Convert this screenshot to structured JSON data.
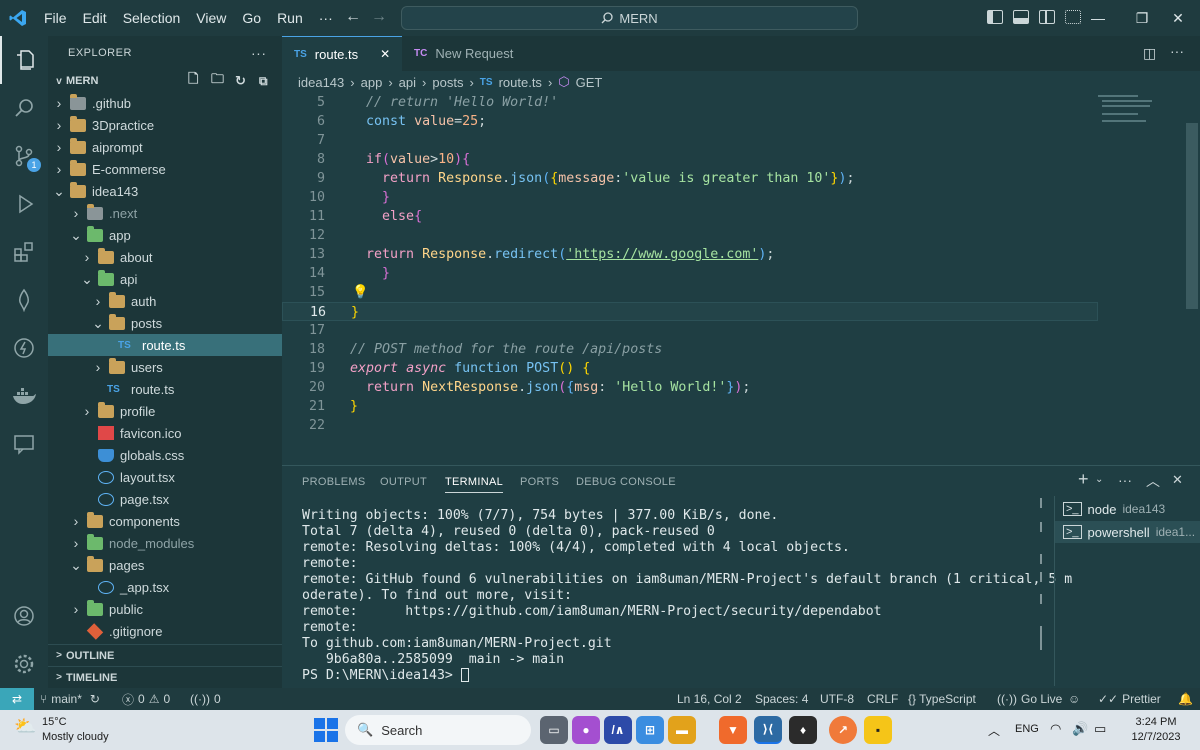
{
  "titlebar": {
    "menu": [
      "File",
      "Edit",
      "Selection",
      "View",
      "Go",
      "Run",
      "···"
    ],
    "search": "MERN"
  },
  "sidebar": {
    "header": "EXPLORER",
    "root": "MERN",
    "tree": [
      {
        "label": ".github",
        "depth": 1,
        "chevron": ">",
        "icon": "folder-github"
      },
      {
        "label": "3Dpractice",
        "depth": 1,
        "chevron": ">",
        "icon": "folder"
      },
      {
        "label": "aiprompt",
        "depth": 1,
        "chevron": ">",
        "icon": "folder"
      },
      {
        "label": "E-commerse",
        "depth": 1,
        "chevron": ">",
        "icon": "folder"
      },
      {
        "label": "idea143",
        "depth": 1,
        "chevron": "v",
        "icon": "folder"
      },
      {
        "label": ".next",
        "depth": 2,
        "chevron": ">",
        "icon": "folder-next"
      },
      {
        "label": "app",
        "depth": 2,
        "chevron": "v",
        "icon": "folder-green"
      },
      {
        "label": "about",
        "depth": 3,
        "chevron": ">",
        "icon": "folder"
      },
      {
        "label": "api",
        "depth": 3,
        "chevron": "v",
        "icon": "folder-green"
      },
      {
        "label": "auth",
        "depth": 4,
        "chevron": ">",
        "icon": "folder"
      },
      {
        "label": "posts",
        "depth": 4,
        "chevron": "v",
        "icon": "folder"
      },
      {
        "label": "route.ts",
        "depth": 5,
        "chevron": "",
        "icon": "ts",
        "selected": true
      },
      {
        "label": "users",
        "depth": 4,
        "chevron": ">",
        "icon": "folder"
      },
      {
        "label": "route.ts",
        "depth": 4,
        "chevron": "",
        "icon": "ts"
      },
      {
        "label": "profile",
        "depth": 3,
        "chevron": ">",
        "icon": "folder"
      },
      {
        "label": "favicon.ico",
        "depth": 3,
        "chevron": "",
        "icon": "favicon"
      },
      {
        "label": "globals.css",
        "depth": 3,
        "chevron": "",
        "icon": "css"
      },
      {
        "label": "layout.tsx",
        "depth": 3,
        "chevron": "",
        "icon": "react"
      },
      {
        "label": "page.tsx",
        "depth": 3,
        "chevron": "",
        "icon": "react"
      },
      {
        "label": "components",
        "depth": 2,
        "chevron": ">",
        "icon": "folder"
      },
      {
        "label": "node_modules",
        "depth": 2,
        "chevron": ">",
        "icon": "folder-green"
      },
      {
        "label": "pages",
        "depth": 2,
        "chevron": "v",
        "icon": "folder"
      },
      {
        "label": "_app.tsx",
        "depth": 3,
        "chevron": "",
        "icon": "react"
      },
      {
        "label": "public",
        "depth": 2,
        "chevron": ">",
        "icon": "folder-green"
      },
      {
        "label": ".gitignore",
        "depth": 2,
        "chevron": "",
        "icon": "git"
      }
    ],
    "outline": "OUTLINE",
    "timeline": "TIMELINE"
  },
  "tabs": [
    {
      "prefix": "TS",
      "label": "route.ts",
      "active": true
    },
    {
      "prefix": "TC",
      "label": "New Request",
      "active": false
    }
  ],
  "breadcrumb": [
    "idea143",
    "app",
    "api",
    "posts",
    "route.ts",
    "GET"
  ],
  "editor": {
    "current_line": 16,
    "line_numbers": [
      "5",
      "6",
      "7",
      "8",
      "9",
      "10",
      "11",
      "12",
      "13",
      "14",
      "15",
      "16",
      "17",
      "18",
      "19",
      "20",
      "21",
      "22"
    ]
  },
  "panel": {
    "tabs": [
      "PROBLEMS",
      "OUTPUT",
      "TERMINAL",
      "PORTS",
      "DEBUG CONSOLE"
    ],
    "active_tab": "TERMINAL",
    "terminal_lines": [
      "Writing objects: 100% (7/7), 754 bytes | 377.00 KiB/s, done.",
      "Total 7 (delta 4), reused 0 (delta 0), pack-reused 0",
      "remote: Resolving deltas: 100% (4/4), completed with 4 local objects.",
      "remote:",
      "remote: GitHub found 6 vulnerabilities on iam8uman/MERN-Project's default branch (1 critical, 5 m",
      "oderate). To find out more, visit:",
      "remote:      https://github.com/iam8uman/MERN-Project/security/dependabot",
      "remote:",
      "To github.com:iam8uman/MERN-Project.git",
      "   9b6a80a..2585099  main -> main",
      "PS D:\\MERN\\idea143> "
    ],
    "terminals": [
      {
        "name": "node",
        "sub": "idea143"
      },
      {
        "name": "powershell",
        "sub": "idea1..."
      }
    ]
  },
  "statusbar": {
    "branch": "main*",
    "errors": "0",
    "warnings": "0",
    "ports": "0",
    "position": "Ln 16, Col 2",
    "spaces": "Spaces: 4",
    "encoding": "UTF-8",
    "eol": "CRLF",
    "language": "{} TypeScript",
    "golive": "Go Live",
    "prettier": "Prettier"
  },
  "taskbar": {
    "weather_temp": "15°C",
    "weather_desc": "Mostly cloudy",
    "search": "Search",
    "lang": "ENG",
    "time": "3:24 PM",
    "date": "12/7/2023"
  }
}
